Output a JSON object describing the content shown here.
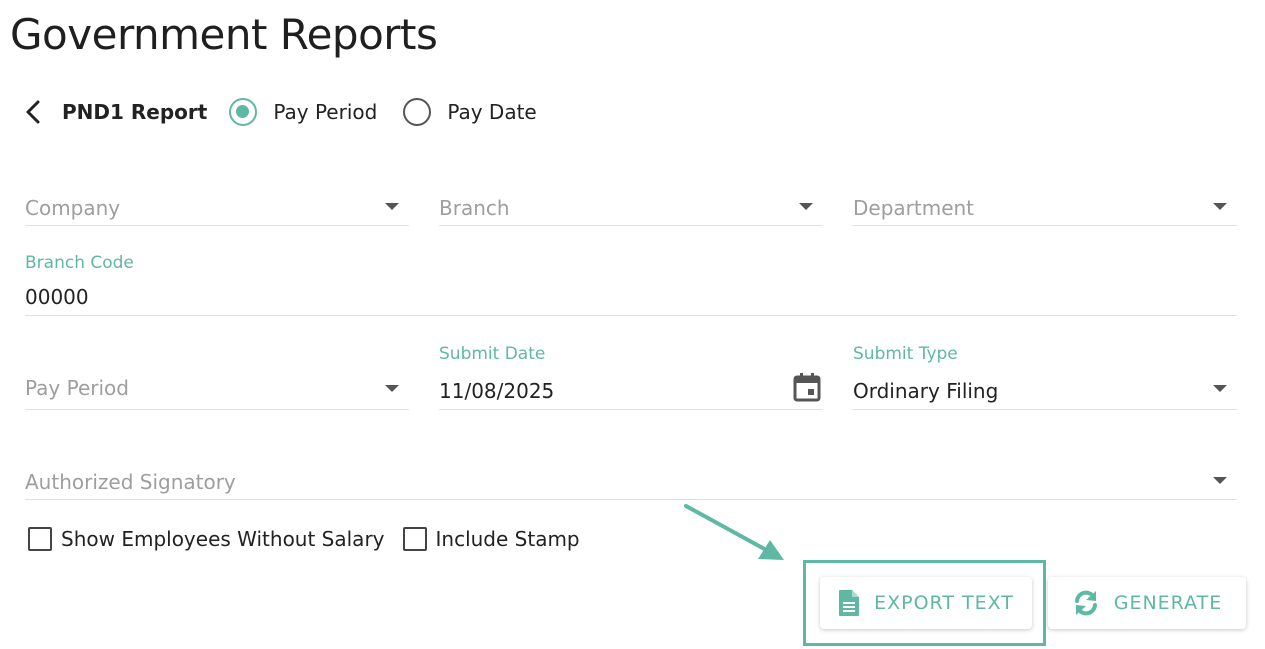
{
  "page": {
    "title": "Government Reports"
  },
  "report": {
    "name": "PND1 Report",
    "radio_options": [
      {
        "label": "Pay Period",
        "checked": true
      },
      {
        "label": "Pay Date",
        "checked": false
      }
    ]
  },
  "form": {
    "company": {
      "placeholder": "Company"
    },
    "branch": {
      "placeholder": "Branch"
    },
    "department": {
      "placeholder": "Department"
    },
    "branch_code": {
      "label": "Branch Code",
      "value": "00000"
    },
    "pay_period": {
      "placeholder": "Pay Period"
    },
    "submit_date": {
      "label": "Submit Date",
      "value": "11/08/2025"
    },
    "submit_type": {
      "label": "Submit Type",
      "value": "Ordinary Filing"
    },
    "authorized_signatory": {
      "placeholder": "Authorized Signatory"
    }
  },
  "checkboxes": [
    {
      "label": "Show Employees Without Salary",
      "checked": false
    },
    {
      "label": "Include Stamp",
      "checked": false
    }
  ],
  "actions": {
    "export_label": "EXPORT TEXT",
    "generate_label": "GENERATE"
  },
  "colors": {
    "accent": "#5fb8a4",
    "placeholder": "#9e9e9e",
    "divider": "#e0e0e0"
  },
  "icons": [
    "chevron-left-icon",
    "caret-down-icon",
    "calendar-icon",
    "document-icon",
    "refresh-icon",
    "arrow-annotation"
  ]
}
